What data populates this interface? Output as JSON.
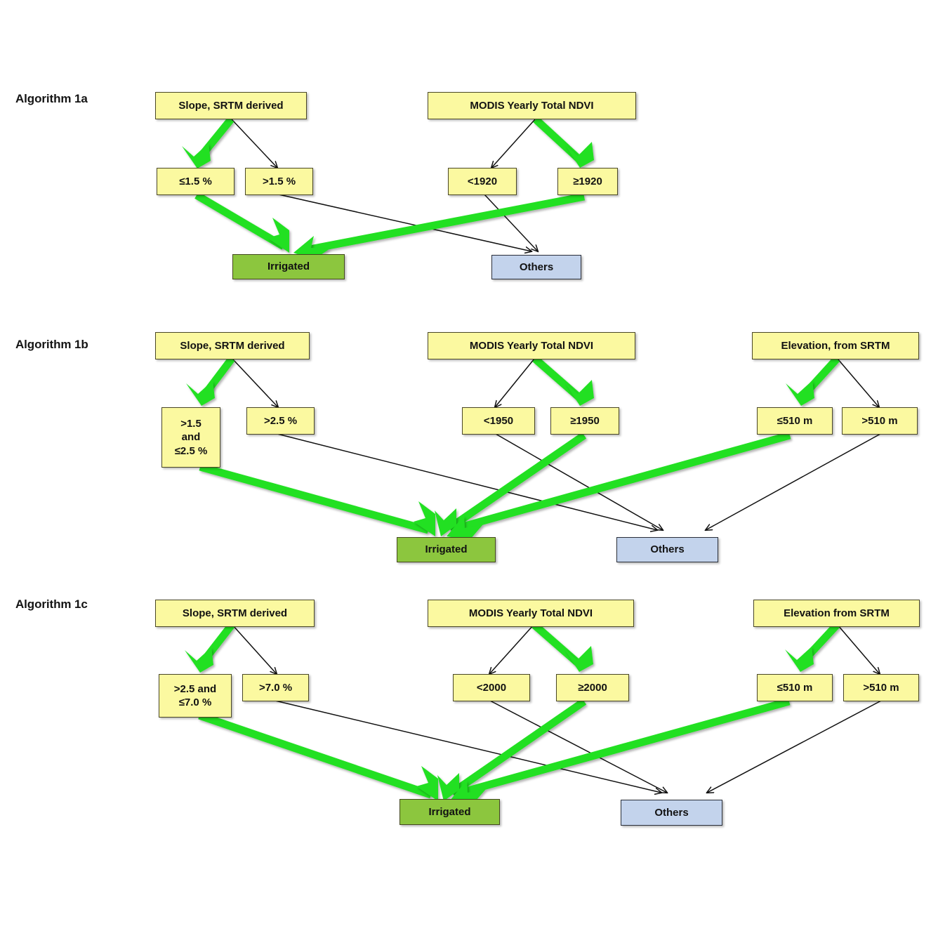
{
  "figure": {
    "background": "#ffffff",
    "colors": {
      "source_box": "#fbf9a0",
      "condition_box": "#fbf9a0",
      "irrigated_box": "#8cc63e",
      "others_box": "#c3d3ec",
      "highlight_arrow": "#22e022",
      "plain_arrow": "#111111",
      "text": "#121212"
    }
  },
  "algorithms": [
    {
      "id": "1a",
      "label": "Algorithm 1a",
      "sources": [
        {
          "id": "a-slope",
          "label": "Slope, SRTM derived"
        },
        {
          "id": "a-ndvi",
          "label": "MODIS Yearly Total NDVI"
        }
      ],
      "conditions": [
        {
          "id": "a-c1",
          "label": "≤1.5 %",
          "highlighted": true,
          "leads_to": "Irrigated"
        },
        {
          "id": "a-c2",
          "label": ">1.5 %",
          "highlighted": false,
          "leads_to": "Others"
        },
        {
          "id": "a-c3",
          "label": "<1920",
          "highlighted": false,
          "leads_to": "Others"
        },
        {
          "id": "a-c4",
          "label": "≥1920",
          "highlighted": true,
          "leads_to": "Irrigated"
        }
      ],
      "outcomes": [
        {
          "id": "a-irr",
          "label": "Irrigated",
          "type": "irrigated"
        },
        {
          "id": "a-oth",
          "label": "Others",
          "type": "others"
        }
      ]
    },
    {
      "id": "1b",
      "label": "Algorithm 1b",
      "sources": [
        {
          "id": "b-slope",
          "label": "Slope, SRTM derived"
        },
        {
          "id": "b-ndvi",
          "label": "MODIS Yearly Total NDVI"
        },
        {
          "id": "b-elev",
          "label": "Elevation, from SRTM"
        }
      ],
      "conditions": [
        {
          "id": "b-c1",
          "label": ">1.5\nand\n≤2.5 %",
          "highlighted": true,
          "leads_to": "Irrigated"
        },
        {
          "id": "b-c2",
          "label": ">2.5 %",
          "highlighted": false,
          "leads_to": "Others"
        },
        {
          "id": "b-c3",
          "label": "<1950",
          "highlighted": false,
          "leads_to": "Others"
        },
        {
          "id": "b-c4",
          "label": "≥1950",
          "highlighted": true,
          "leads_to": "Irrigated"
        },
        {
          "id": "b-c5",
          "label": "≤510 m",
          "highlighted": true,
          "leads_to": "Irrigated"
        },
        {
          "id": "b-c6",
          "label": ">510 m",
          "highlighted": false,
          "leads_to": "Others"
        }
      ],
      "outcomes": [
        {
          "id": "b-irr",
          "label": "Irrigated",
          "type": "irrigated"
        },
        {
          "id": "b-oth",
          "label": "Others",
          "type": "others"
        }
      ]
    },
    {
      "id": "1c",
      "label": "Algorithm 1c",
      "sources": [
        {
          "id": "c-slope",
          "label": "Slope, SRTM derived"
        },
        {
          "id": "c-ndvi",
          "label": "MODIS Yearly Total NDVI"
        },
        {
          "id": "c-elev",
          "label": "Elevation from SRTM"
        }
      ],
      "conditions": [
        {
          "id": "c-c1",
          "label": ">2.5 and\n≤7.0 %",
          "highlighted": true,
          "leads_to": "Irrigated"
        },
        {
          "id": "c-c2",
          "label": ">7.0 %",
          "highlighted": false,
          "leads_to": "Others"
        },
        {
          "id": "c-c3",
          "label": "<2000",
          "highlighted": false,
          "leads_to": "Others"
        },
        {
          "id": "c-c4",
          "label": "≥2000",
          "highlighted": true,
          "leads_to": "Irrigated"
        },
        {
          "id": "c-c5",
          "label": "≤510 m",
          "highlighted": true,
          "leads_to": "Irrigated"
        },
        {
          "id": "c-c6",
          "label": ">510 m",
          "highlighted": false,
          "leads_to": "Others"
        }
      ],
      "outcomes": [
        {
          "id": "c-irr",
          "label": "Irrigated",
          "type": "irrigated"
        },
        {
          "id": "c-oth",
          "label": "Others",
          "type": "others"
        }
      ]
    }
  ]
}
